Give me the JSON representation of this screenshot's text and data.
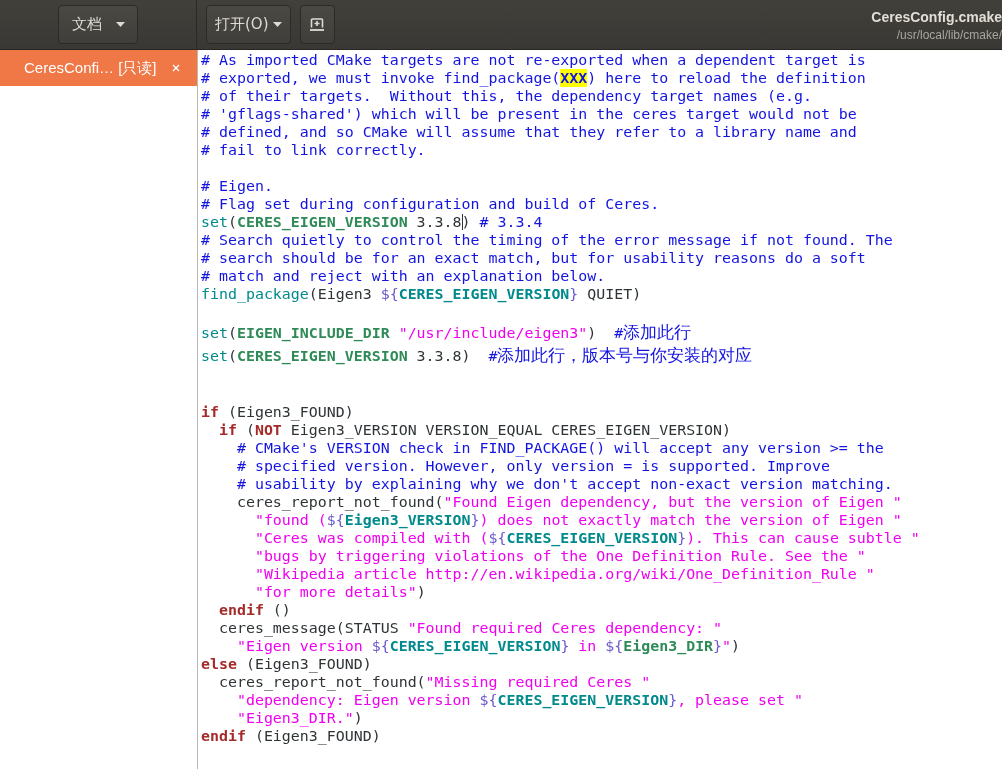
{
  "header": {
    "documents_button": {
      "label": "文档"
    },
    "open_button": {
      "label": "打开(O)"
    },
    "title": "CeresConfig.cmake",
    "subtitle": "/usr/local/lib/cmake/"
  },
  "sidebar": {
    "documents": [
      {
        "label": "CeresConfi… [只读]",
        "selected": true
      }
    ]
  },
  "editor": {
    "lines": [
      {
        "kind": "code",
        "segments": [
          {
            "kind": "comment",
            "text": "# As imported CMake targets are not re-exported when a dependent target is"
          }
        ]
      },
      {
        "kind": "code",
        "segments": [
          {
            "kind": "comment",
            "text": "# exported, we must invoke find_package("
          },
          {
            "kind": "match",
            "text": "XXX"
          },
          {
            "kind": "comment",
            "text": ") here to reload the definition"
          }
        ]
      },
      {
        "kind": "code",
        "segments": [
          {
            "kind": "comment",
            "text": "# of their targets.  Without this, the dependency target names (e.g."
          }
        ]
      },
      {
        "kind": "code",
        "segments": [
          {
            "kind": "comment",
            "text": "# 'gflags-shared') which will be present in the ceres target would not be"
          }
        ]
      },
      {
        "kind": "code",
        "segments": [
          {
            "kind": "comment",
            "text": "# defined, and so CMake will assume that they refer to a library name and"
          }
        ]
      },
      {
        "kind": "code",
        "segments": [
          {
            "kind": "comment",
            "text": "# fail to link correctly."
          }
        ]
      },
      {
        "kind": "blank"
      },
      {
        "kind": "code",
        "segments": [
          {
            "kind": "comment",
            "text": "# Eigen."
          }
        ]
      },
      {
        "kind": "code",
        "segments": [
          {
            "kind": "comment",
            "text": "# Flag set during configuration and build of Ceres."
          }
        ]
      },
      {
        "kind": "code",
        "segments": [
          {
            "kind": "command",
            "text": "set"
          },
          {
            "kind": "plain",
            "text": "("
          },
          {
            "kind": "variable",
            "text": "CERES_EIGEN_VERSION"
          },
          {
            "kind": "plain",
            "text": " 3.3.8",
            "cursor_after": true
          },
          {
            "kind": "plain",
            "text": ") "
          },
          {
            "kind": "comment",
            "text": "# 3.3.4"
          }
        ]
      },
      {
        "kind": "code",
        "segments": [
          {
            "kind": "comment",
            "text": "# Search quietly to control the timing of the error message if not found. The"
          }
        ]
      },
      {
        "kind": "code",
        "segments": [
          {
            "kind": "comment",
            "text": "# search should be for an exact match, but for usability reasons do a soft"
          }
        ]
      },
      {
        "kind": "code",
        "segments": [
          {
            "kind": "comment",
            "text": "# match and reject with an explanation below."
          }
        ]
      },
      {
        "kind": "code",
        "segments": [
          {
            "kind": "command",
            "text": "find_package"
          },
          {
            "kind": "plain",
            "text": "(Eigen3 "
          },
          {
            "kind": "brace",
            "text": "${"
          },
          {
            "kind": "varref",
            "text": "CERES_EIGEN_VERSION"
          },
          {
            "kind": "brace",
            "text": "}"
          },
          {
            "kind": "plain",
            "text": " QUIET)"
          }
        ]
      },
      {
        "kind": "blank"
      },
      {
        "kind": "code",
        "segments": [
          {
            "kind": "command",
            "text": "set"
          },
          {
            "kind": "plain",
            "text": "("
          },
          {
            "kind": "variable",
            "text": "EIGEN_INCLUDE_DIR"
          },
          {
            "kind": "string",
            "text": " \"/usr/include/eigen3\""
          },
          {
            "kind": "plain",
            "text": ")  "
          },
          {
            "kind": "comment",
            "text": "#添加此行"
          }
        ]
      },
      {
        "kind": "code",
        "segments": [
          {
            "kind": "command",
            "text": "set"
          },
          {
            "kind": "plain",
            "text": "("
          },
          {
            "kind": "variable",
            "text": "CERES_EIGEN_VERSION"
          },
          {
            "kind": "plain",
            "text": " 3.3.8)  "
          },
          {
            "kind": "comment",
            "text": "#添加此行，版本号与你安装的对应"
          }
        ]
      },
      {
        "kind": "blank"
      },
      {
        "kind": "blank"
      },
      {
        "kind": "code",
        "segments": [
          {
            "kind": "control",
            "text": "if"
          },
          {
            "kind": "plain",
            "text": " (Eigen3_FOUND)"
          }
        ]
      },
      {
        "kind": "code",
        "segments": [
          {
            "kind": "control",
            "text": "  if"
          },
          {
            "kind": "plain",
            "text": " ("
          },
          {
            "kind": "control",
            "text": "NOT"
          },
          {
            "kind": "plain",
            "text": " Eigen3_VERSION VERSION_EQUAL CERES_EIGEN_VERSION)"
          }
        ]
      },
      {
        "kind": "code",
        "segments": [
          {
            "kind": "comment",
            "text": "    # CMake's VERSION check in FIND_PACKAGE() will accept any version >= the"
          }
        ]
      },
      {
        "kind": "code",
        "segments": [
          {
            "kind": "comment",
            "text": "    # specified version. However, only version = is supported. Improve"
          }
        ]
      },
      {
        "kind": "code",
        "segments": [
          {
            "kind": "comment",
            "text": "    # usability by explaining why we don't accept non-exact version matching."
          }
        ]
      },
      {
        "kind": "code",
        "segments": [
          {
            "kind": "plain",
            "text": "    ceres_report_not_found("
          },
          {
            "kind": "string",
            "text": "\"Found Eigen dependency, but the version of Eigen \""
          }
        ]
      },
      {
        "kind": "code",
        "segments": [
          {
            "kind": "string",
            "text": "      \"found ("
          },
          {
            "kind": "brace",
            "text": "${"
          },
          {
            "kind": "varref",
            "text": "Eigen3_VERSION"
          },
          {
            "kind": "brace",
            "text": "}"
          },
          {
            "kind": "string",
            "text": ") does not exactly match the version of Eigen \""
          }
        ]
      },
      {
        "kind": "code",
        "segments": [
          {
            "kind": "string",
            "text": "      \"Ceres was compiled with ("
          },
          {
            "kind": "brace",
            "text": "${"
          },
          {
            "kind": "varref",
            "text": "CERES_EIGEN_VERSION"
          },
          {
            "kind": "brace",
            "text": "}"
          },
          {
            "kind": "string",
            "text": "). This can cause subtle \""
          }
        ]
      },
      {
        "kind": "code",
        "segments": [
          {
            "kind": "string",
            "text": "      \"bugs by triggering violations of the One Definition Rule. See the \""
          }
        ]
      },
      {
        "kind": "code",
        "segments": [
          {
            "kind": "string",
            "text": "      \"Wikipedia article http://en.wikipedia.org/wiki/One_Definition_Rule \""
          }
        ]
      },
      {
        "kind": "code",
        "segments": [
          {
            "kind": "string",
            "text": "      \"for more details\""
          },
          {
            "kind": "plain",
            "text": ")"
          }
        ]
      },
      {
        "kind": "code",
        "segments": [
          {
            "kind": "control",
            "text": "  endif"
          },
          {
            "kind": "plain",
            "text": " ()"
          }
        ]
      },
      {
        "kind": "code",
        "segments": [
          {
            "kind": "plain",
            "text": "  ceres_message(STATUS "
          },
          {
            "kind": "string",
            "text": "\"Found required Ceres dependency: \""
          }
        ]
      },
      {
        "kind": "code",
        "segments": [
          {
            "kind": "string",
            "text": "    \"Eigen version "
          },
          {
            "kind": "brace",
            "text": "${"
          },
          {
            "kind": "varref",
            "text": "CERES_EIGEN_VERSION"
          },
          {
            "kind": "brace",
            "text": "}"
          },
          {
            "kind": "string",
            "text": " in "
          },
          {
            "kind": "brace",
            "text": "${"
          },
          {
            "kind": "variable",
            "text": "Eigen3_DIR"
          },
          {
            "kind": "brace",
            "text": "}"
          },
          {
            "kind": "string",
            "text": "\""
          },
          {
            "kind": "plain",
            "text": ")"
          }
        ]
      },
      {
        "kind": "code",
        "segments": [
          {
            "kind": "control",
            "text": "else"
          },
          {
            "kind": "plain",
            "text": " (Eigen3_FOUND)"
          }
        ]
      },
      {
        "kind": "code",
        "segments": [
          {
            "kind": "plain",
            "text": "  ceres_report_not_found("
          },
          {
            "kind": "string",
            "text": "\"Missing required Ceres \""
          }
        ]
      },
      {
        "kind": "code",
        "segments": [
          {
            "kind": "string",
            "text": "    \"dependency: Eigen version "
          },
          {
            "kind": "brace",
            "text": "${"
          },
          {
            "kind": "varref",
            "text": "CERES_EIGEN_VERSION"
          },
          {
            "kind": "brace",
            "text": "}"
          },
          {
            "kind": "string",
            "text": ", please set \""
          }
        ]
      },
      {
        "kind": "code",
        "segments": [
          {
            "kind": "string",
            "text": "    \"Eigen3_DIR.\""
          },
          {
            "kind": "plain",
            "text": ")"
          }
        ]
      },
      {
        "kind": "code",
        "segments": [
          {
            "kind": "control",
            "text": "endif"
          },
          {
            "kind": "plain",
            "text": " (Eigen3_FOUND)"
          }
        ]
      }
    ]
  }
}
